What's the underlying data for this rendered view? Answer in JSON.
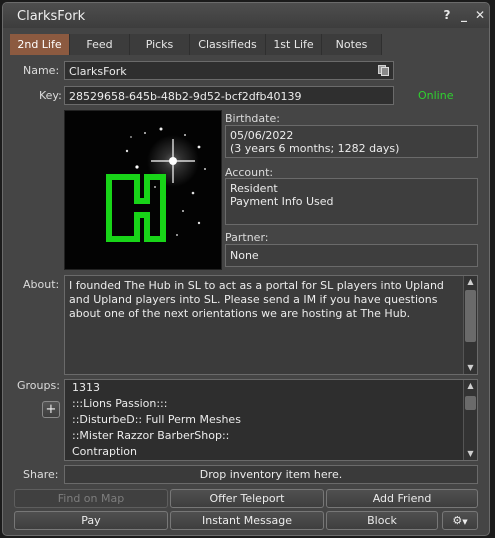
{
  "window": {
    "title": "ClarksFork"
  },
  "titlebar_controls": {
    "help": "?",
    "minimize": "_",
    "close": "✕"
  },
  "tabs": [
    {
      "label": "2nd Life",
      "active": true
    },
    {
      "label": "Feed"
    },
    {
      "label": "Picks"
    },
    {
      "label": "Classifieds"
    },
    {
      "label": "1st Life"
    },
    {
      "label": "Notes"
    }
  ],
  "profile": {
    "name_label": "Name:",
    "name": "ClarksFork",
    "key_label": "Key:",
    "key": "28529658-645b-48b2-9d52-bcf2dfb40139",
    "status": "Online",
    "birthdate_label": "Birthdate:",
    "birthdate": "05/06/2022",
    "age": "(3 years 6 months; 1282 days)",
    "account_label": "Account:",
    "account_type": "Resident",
    "payment_info": "Payment Info Used",
    "partner_label": "Partner:",
    "partner": "None",
    "about_label": "About:",
    "about": "I founded The Hub in SL to act as a portal for SL players into Upland and Upland players into SL. Please send a IM if you have questions about one of the next orientations we are hosting at The Hub.",
    "groups_label": "Groups:",
    "groups": [
      "1313",
      ":::Lions Passion:::",
      "::DisturbeD:: Full Perm Meshes",
      "::Mister Razzor BarberShop::",
      "Contraption"
    ],
    "share_label": "Share:",
    "share_drop": "Drop inventory item here."
  },
  "buttons": {
    "find_on_map": "Find on Map",
    "offer_teleport": "Offer Teleport",
    "add_friend": "Add Friend",
    "pay": "Pay",
    "instant_message": "Instant Message",
    "block": "Block",
    "add_group": "+"
  },
  "colors": {
    "online": "#2fd12f",
    "active_tab": "#8c5a40",
    "logo_green": "#18d418"
  },
  "icons": [
    "copy-icon",
    "gear-icon",
    "chevron-down-icon",
    "scroll-up-icon",
    "scroll-down-icon"
  ]
}
